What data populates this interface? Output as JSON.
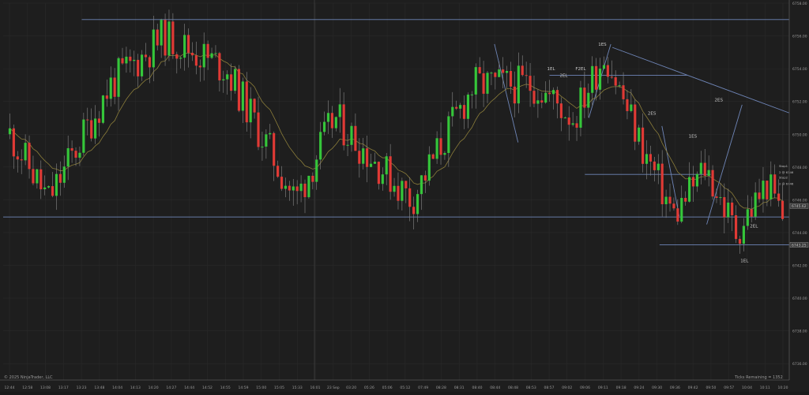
{
  "chart_data": {
    "type": "candlestick",
    "title": "",
    "xlabel": "",
    "ylabel": "",
    "ylim": [
      6735,
      6758
    ],
    "grid": true,
    "y_ticks": [
      "6736.00",
      "6738.00",
      "6740.00",
      "6742.00",
      "6744.00",
      "6746.00",
      "6748.00",
      "6750.00",
      "6752.00",
      "6754.00",
      "6756.00",
      "6758.00"
    ],
    "y_tick_values": [
      6736,
      6738,
      6740,
      6742,
      6744,
      6746,
      6748,
      6750,
      6752,
      6754,
      6756,
      6758
    ],
    "x_ticks": [
      "12:44",
      "12:58",
      "13:08",
      "13:17",
      "13:23",
      "13:48",
      "14:04",
      "14:13",
      "14:20",
      "14:27",
      "14:44",
      "14:52",
      "14:55",
      "14:59",
      "15:00",
      "15:05",
      "15:33",
      "16:01",
      "23 Sep",
      "03:20",
      "05:26",
      "05:06",
      "05:12",
      "07:49",
      "08:28",
      "08:31",
      "08:40",
      "08:44",
      "08:48",
      "08:53",
      "08:57",
      "09:02",
      "09:06",
      "09:11",
      "09:18",
      "09:24",
      "09:30",
      "09:36",
      "09:42",
      "09:50",
      "09:57",
      "10:04",
      "10:11",
      "10:20"
    ],
    "price_labels": [
      {
        "text": "6745.62",
        "value": 6745.62,
        "color": "#c8c8c8"
      },
      {
        "text": "6743.25",
        "value": 6743.25,
        "color": "#c8c8c8"
      }
    ],
    "horizontal_lines": [
      {
        "value": 6757.0,
        "x_from": 0.1,
        "x_to": 1.0,
        "color": "#6f86b8"
      },
      {
        "value": 6744.95,
        "x_from": 0.0,
        "x_to": 1.0,
        "color": "#6f86b8"
      },
      {
        "value": 6753.6,
        "x_from": 0.695,
        "x_to": 0.87,
        "color": "#6f86b8"
      },
      {
        "value": 6747.55,
        "x_from": 0.74,
        "x_to": 0.9,
        "color": "#6f86b8"
      },
      {
        "value": 6743.25,
        "x_from": 0.835,
        "x_to": 1.0,
        "color": "#6f86b8"
      }
    ],
    "trendlines": [
      {
        "x1": 0.775,
        "y1": 6755.3,
        "x2": 1.0,
        "y2": 6751.3,
        "color": "#6f86b8"
      },
      {
        "x1": 0.625,
        "y1": 6755.5,
        "x2": 0.655,
        "y2": 6749.5,
        "color": "#6f86b8"
      },
      {
        "x1": 0.745,
        "y1": 6751.0,
        "x2": 0.773,
        "y2": 6755.5,
        "color": "#6f86b8"
      },
      {
        "x1": 0.838,
        "y1": 6750.5,
        "x2": 0.86,
        "y2": 6745.0,
        "color": "#6f86b8"
      },
      {
        "x1": 0.895,
        "y1": 6744.5,
        "x2": 0.94,
        "y2": 6751.8,
        "color": "#6f86b8"
      }
    ],
    "signal_labels": [
      {
        "text": "1ES",
        "x": 0.757,
        "value": 6755.4
      },
      {
        "text": "1EL",
        "x": 0.692,
        "value": 6753.9
      },
      {
        "text": "F2EL",
        "x": 0.728,
        "value": 6753.9
      },
      {
        "text": "2EL",
        "x": 0.708,
        "value": 6753.5
      },
      {
        "text": "2ES",
        "x": 0.82,
        "value": 6751.2
      },
      {
        "text": "1ES",
        "x": 0.872,
        "value": 6749.8
      },
      {
        "text": "2ES",
        "x": 0.905,
        "value": 6752.0
      },
      {
        "text": "2EL",
        "x": 0.95,
        "value": 6744.3
      },
      {
        "text": "1EL",
        "x": 0.938,
        "value": 6742.2
      }
    ],
    "order_labels": [
      {
        "text": "Stop1",
        "value": 6748.0
      },
      {
        "text": "2 @ 6746",
        "value": 6747.6
      },
      {
        "text": "Stop2",
        "value": 6747.3
      },
      {
        "text": "2 @ 6746",
        "value": 6746.9
      }
    ],
    "footer_left": "© 2025 NinjaTrader, LLC",
    "footer_right": "Ticks Remaining = 1352",
    "colors": {
      "background": "#1e1e1e",
      "up": "#35c63a",
      "down": "#e03a35",
      "wick": "#8a8a8a",
      "ema": "#8b7d3a",
      "lines": "#6f86b8",
      "text": "#9a9a9a"
    }
  }
}
